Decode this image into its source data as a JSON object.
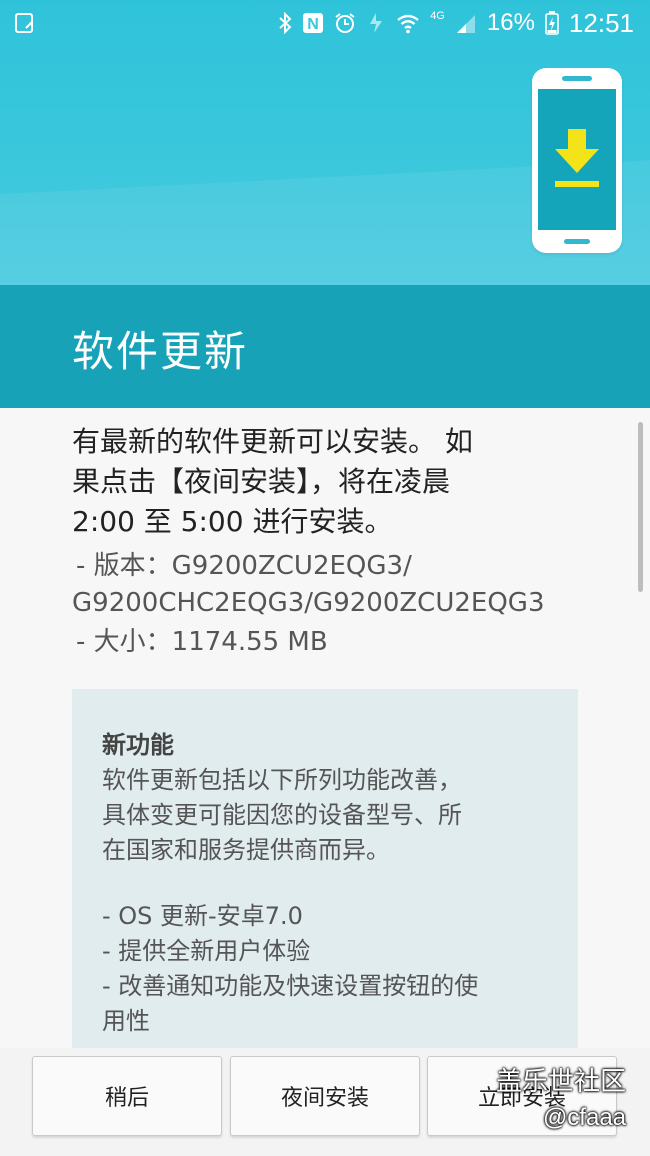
{
  "status_bar": {
    "battery_percent": "16%",
    "time": "12:51",
    "network": "4G"
  },
  "header": {
    "title": "软件更新"
  },
  "body": {
    "intro_lines": [
      "有最新的软件更新可以安装。 如",
      "果点击【夜间安装】，将在凌晨",
      "2:00 至 5:00 进行安装。"
    ],
    "version_label": "- 版本：G9200ZCU2EQG3/",
    "version_cont": "G9200CHC2EQG3/G9200ZCU2EQG3",
    "size_label": "- 大小：1174.55 MB"
  },
  "whats_new": {
    "heading": "新功能",
    "desc_lines": [
      "软件更新包括以下所列功能改善，",
      "具体变更可能因您的设备型号、所",
      "在国家和服务提供商而异。"
    ],
    "items": [
      "- OS 更新-安卓7.0",
      "- 提供全新用户体验",
      "- 改善通知功能及快速设置按钮的使",
      "用性"
    ]
  },
  "buttons": {
    "later": "稍后",
    "night_install": "夜间安装",
    "install_now": "立即安装"
  },
  "watermark": {
    "text": "盖乐世社区",
    "handle": "@cfaaa"
  },
  "colors": {
    "header_top": "#3ac7dc",
    "header_band": "#17a2b7",
    "accent_yellow": "#f2e418"
  }
}
